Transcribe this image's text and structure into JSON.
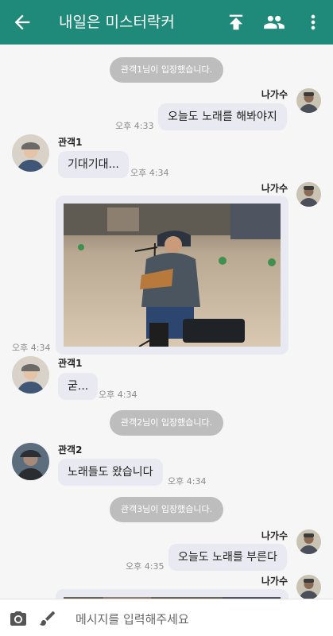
{
  "header": {
    "title": "내일은 미스터락커",
    "background": "#1f8a7a"
  },
  "messages": {
    "sys1": "관객1님이 입장했습니다.",
    "sys2": "관객2님이 입장했습니다.",
    "sys3": "관객3님이 입장했습니다.",
    "m1": {
      "name": "나가수",
      "text": "오늘도 노래를 해봐야지",
      "time": "오후 4:33"
    },
    "m2": {
      "name": "관객1",
      "text": "기대기대...",
      "time": "오후 4:34"
    },
    "m3": {
      "name": "나가수",
      "time": "오후 4:34"
    },
    "m4": {
      "name": "관객1",
      "text": "굳...",
      "time": "오후 4:34"
    },
    "m5": {
      "name": "관객2",
      "text": "노래들도 왔습니다",
      "time": "오후 4:34"
    },
    "m6": {
      "name": "나가수",
      "text": "오늘도 노래를 부른다",
      "time": "오후 4:35"
    },
    "m7": {
      "name": "나가수"
    }
  },
  "composer": {
    "placeholder": "메시지를 입력해주세요"
  },
  "icons": {
    "back": "arrow-left-icon",
    "upload": "upload-icon",
    "people": "people-icon",
    "more": "more-vert-icon",
    "camera": "camera-icon",
    "brush": "brush-icon"
  }
}
